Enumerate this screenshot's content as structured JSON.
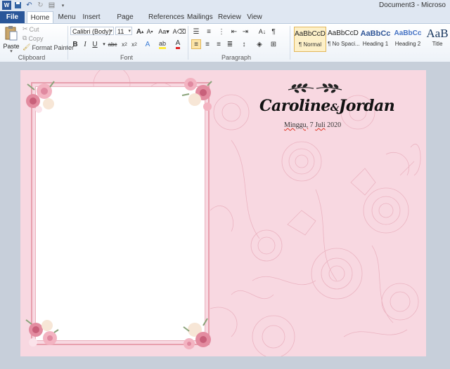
{
  "window": {
    "doc_title": "Document3 - Microso"
  },
  "tabs": [
    {
      "label": "File"
    },
    {
      "label": "Home"
    },
    {
      "label": "Menu"
    },
    {
      "label": "Insert"
    },
    {
      "label": "Page Layout"
    },
    {
      "label": "References"
    },
    {
      "label": "Mailings"
    },
    {
      "label": "Review"
    },
    {
      "label": "View"
    }
  ],
  "clipboard": {
    "paste": "Paste",
    "cut": "Cut",
    "copy": "Copy",
    "format_painter": "Format Painter",
    "group": "Clipboard"
  },
  "font": {
    "name": "Calibri (Body)",
    "size": "11",
    "group": "Font"
  },
  "paragraph": {
    "group": "Paragraph"
  },
  "styles": [
    {
      "preview": "AaBbCcDc",
      "name": "¶ Normal"
    },
    {
      "preview": "AaBbCcDc",
      "name": "¶ No Spaci..."
    },
    {
      "preview": "AaBbCc",
      "name": "Heading 1"
    },
    {
      "preview": "AaBbCc",
      "name": "Heading 2"
    },
    {
      "preview": "AaB",
      "name": "Title"
    }
  ],
  "document": {
    "names_first": "Caroline",
    "names_amp": "&",
    "names_second": "Jordan",
    "date_word": "Minggu,",
    "date_rest": " 7 ",
    "date_month": "Juli",
    "date_year": " 2020"
  },
  "colors": {
    "file_tab": "#2a5699",
    "page_bg": "#f8d8e1",
    "frame": "#e8a0ae"
  }
}
